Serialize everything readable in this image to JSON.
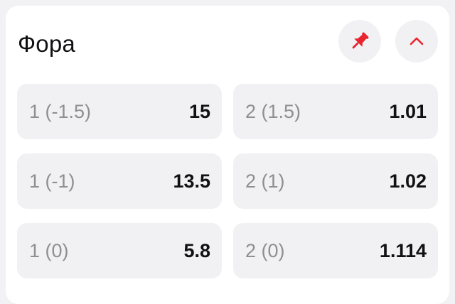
{
  "market": {
    "title": "Фора",
    "icons": {
      "pin": "pin-icon",
      "collapse": "chevron-up-icon"
    },
    "accent_color": "#e8242f"
  },
  "odds": [
    {
      "label": "1 (-1.5)",
      "value": "15"
    },
    {
      "label": "2 (1.5)",
      "value": "1.01"
    },
    {
      "label": "1 (-1)",
      "value": "13.5"
    },
    {
      "label": "2 (1)",
      "value": "1.02"
    },
    {
      "label": "1 (0)",
      "value": "5.8"
    },
    {
      "label": "2 (0)",
      "value": "1.114"
    }
  ]
}
